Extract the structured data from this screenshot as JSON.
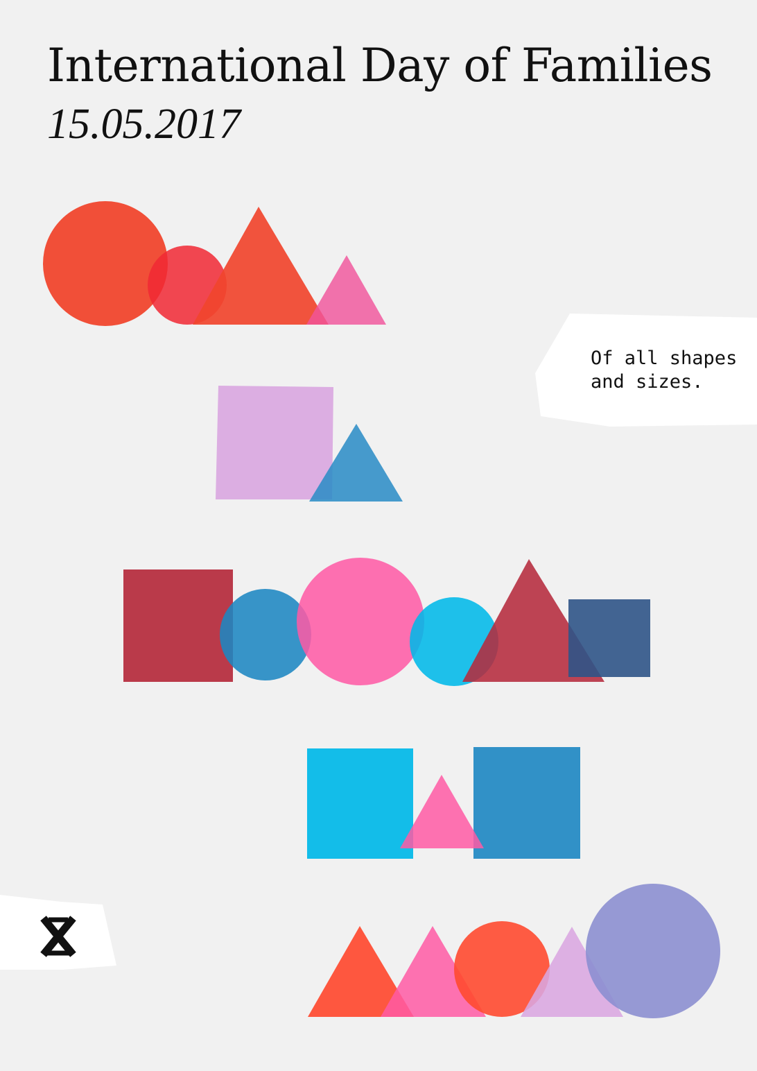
{
  "poster": {
    "title": "International Day of Families",
    "date": "15.05.2017",
    "note_lines": [
      "Of all shapes",
      "and sizes."
    ],
    "logo_icon": "ampersand-x-logo-icon",
    "colors": {
      "background": "#f1f1f1",
      "coral": "#ff4a30",
      "red": "#ff2a36",
      "pink": "#ff5aa5",
      "lilac": "#d9a6e0",
      "blue": "#2d8dc6",
      "cyan": "#00b8e8",
      "maroon": "#b52a3c",
      "navy": "#2f5487",
      "periwinkle": "#8c8fd0",
      "paper": "#ffffff"
    }
  }
}
